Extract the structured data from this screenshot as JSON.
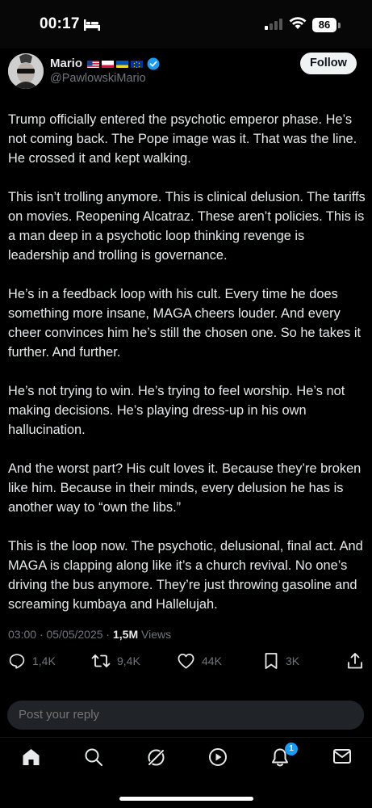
{
  "status_bar": {
    "time": "00:17",
    "battery": "86"
  },
  "header": {
    "display_name": "Mario",
    "handle": "@PawlowskiMario",
    "follow_label": "Follow"
  },
  "tweet": {
    "paragraphs": [
      "Trump officially entered the psychotic emperor phase. He’s not coming back. The Pope image was it. That was the line. He crossed it and kept walking.",
      "This isn’t trolling anymore. This is clinical delusion. The tariffs on movies. Reopening Alcatraz. These aren’t policies. This is a man deep in a psychotic loop thinking revenge is leadership and trolling is governance.",
      "He’s in a feedback loop with his cult. Every time he does something more insane, MAGA cheers louder. And every cheer convinces him he’s still the chosen one. So he takes it further. And further.",
      "He’s not trying to win. He’s trying to feel worship. He’s not making decisions. He’s playing dress-up in his own hallucination.",
      "And the worst part? His cult loves it. Because they’re broken like him. Because in their minds, every delusion he has is another way to “own the libs.”",
      "This is the loop now. The psychotic, delusional, final act. And MAGA is clapping along like it’s a church revival. No one’s driving the bus anymore. They’re just throwing gasoline and screaming kumbaya and  Hallelujah."
    ],
    "timestamp": "03:00 · 05/05/2025 · ",
    "views_count": "1,5M",
    "views_label": " Views"
  },
  "actions": {
    "replies": "1,4K",
    "reposts": "9,4K",
    "likes": "44K",
    "bookmarks": "3K"
  },
  "reply_bar": {
    "placeholder": "Post your reply"
  },
  "bottom_nav": {
    "notifications_badge": "1"
  },
  "colors": {
    "background": "#000000",
    "text": "#e7e9ea",
    "muted": "#71767b",
    "accent": "#1d9bf0"
  }
}
